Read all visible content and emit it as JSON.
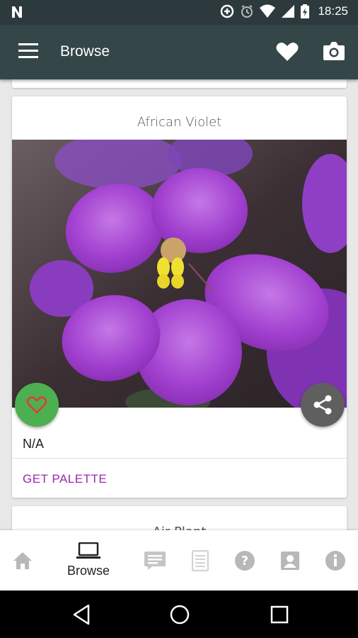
{
  "status_bar": {
    "notification_icon": "n-icon",
    "time": "18:25",
    "colors": {
      "background": "#2d3a3d"
    }
  },
  "app_bar": {
    "title": "Browse",
    "menu_icon": "hamburger-icon",
    "favorite_icon": "heart-icon",
    "camera_icon": "camera-icon",
    "colors": {
      "background": "#354649"
    }
  },
  "plant_card": {
    "title": "African Violet",
    "image_subject": "purple-flower",
    "value": "N/A",
    "action_label": "GET PALETTE",
    "colors": {
      "action": "#9c27b0",
      "favorite_fab": "#4caf50",
      "share_fab": "#5f5f5f"
    }
  },
  "next_card": {
    "title": "Air Plant"
  },
  "bottom_nav": {
    "active_label": "Browse",
    "items": [
      {
        "icon": "home-icon"
      },
      {
        "icon": "laptop-icon"
      },
      {
        "icon": "message-icon"
      },
      {
        "icon": "document-icon"
      },
      {
        "icon": "help-icon"
      },
      {
        "icon": "contact-icon"
      },
      {
        "icon": "info-icon"
      }
    ]
  },
  "system_nav": {
    "items": [
      "back-icon",
      "home-circle-icon",
      "recents-icon"
    ]
  }
}
